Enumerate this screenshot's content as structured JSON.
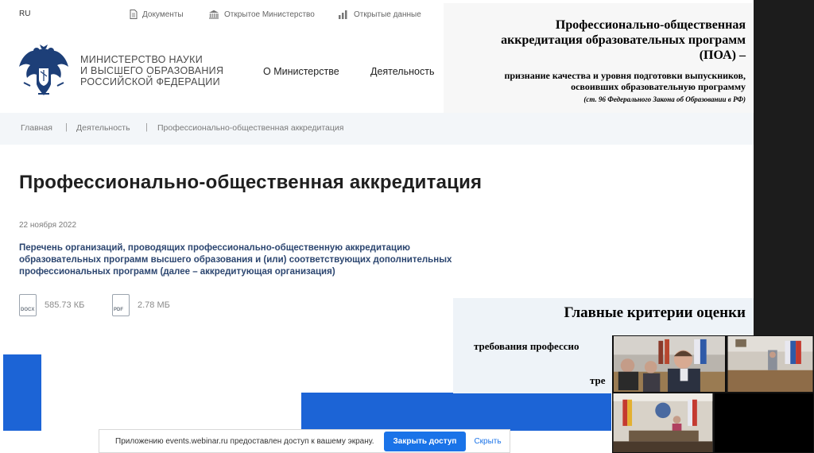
{
  "topbar": {
    "lang": "RU",
    "links": [
      {
        "label": "Документы",
        "icon": "document-icon"
      },
      {
        "label": "Открытое Министерство",
        "icon": "building-icon"
      },
      {
        "label": "Открытые данные",
        "icon": "bar-chart-icon"
      }
    ]
  },
  "header": {
    "ministry_lines": [
      "МИНИСТЕРСТВО НАУКИ",
      "И ВЫСШЕГО ОБРАЗОВАНИЯ",
      "РОССИЙСКОЙ ФЕДЕРАЦИИ"
    ],
    "nav": [
      "О Министерстве",
      "Деятельность"
    ]
  },
  "info_box": {
    "title_lines": [
      "Профессионально-общественная",
      "аккредитация образовательных программ",
      "(ПОА) –"
    ],
    "subtitle_lines": [
      "признание качества и уровня подготовки выпускников,",
      "освоивших образовательную программу"
    ],
    "law": "(ст. 96 Федерального Закона об Образовании в РФ)"
  },
  "breadcrumb": [
    "Главная",
    "Деятельность",
    "Профессионально-общественная аккредитация"
  ],
  "main": {
    "title": "Профессионально-общественная аккредитация",
    "date": "22 ноября 2022",
    "description": "Перечень организаций, проводящих профессионально-общественную аккредитацию образовательных программ высшего образования и (или) соответствующих дополнительных профессиональных программ (далее – аккредитующая организация)",
    "files": [
      {
        "type": "DOCX",
        "size": "585.73 КБ"
      },
      {
        "type": "PDF",
        "size": "2.78 МБ"
      }
    ]
  },
  "criteria_box": {
    "title": "Главные критерии оценки",
    "line1": "требования профессио",
    "line2": "тре"
  },
  "notification": {
    "text": "Приложению events.webinar.ru предоставлен доступ к вашему экрану.",
    "grant_label": "Закрыть доступ",
    "hide_label": "Скрыть"
  },
  "colors": {
    "accent_blue": "#1c64d6",
    "button_blue": "#1a73e8",
    "description_text": "#2c4670"
  }
}
